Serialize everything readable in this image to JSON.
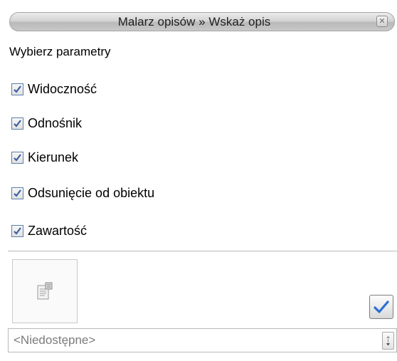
{
  "window": {
    "title": "Malarz opisów » Wskaż opis",
    "close_icon": "close-icon"
  },
  "section": {
    "label": "Wybierz parametry"
  },
  "parameters": [
    {
      "label": "Widoczność",
      "checked": true
    },
    {
      "label": "Odnośnik",
      "checked": true
    },
    {
      "label": "Kierunek",
      "checked": true
    },
    {
      "label": "Odsunięcie od obiektu",
      "checked": true
    },
    {
      "label": "Zawartość",
      "checked": true
    }
  ],
  "actions": {
    "properties_icon": "properties-icon",
    "confirm_icon": "checkmark-icon"
  },
  "combo": {
    "value": "<Niedostępne>",
    "spin_icon": "spinner-icon"
  },
  "colors": {
    "check_blue": "#3a5fa0",
    "confirm_blue": "#2a6fd6",
    "title_text": "#202020",
    "disabled_text": "#7b7b7b"
  }
}
